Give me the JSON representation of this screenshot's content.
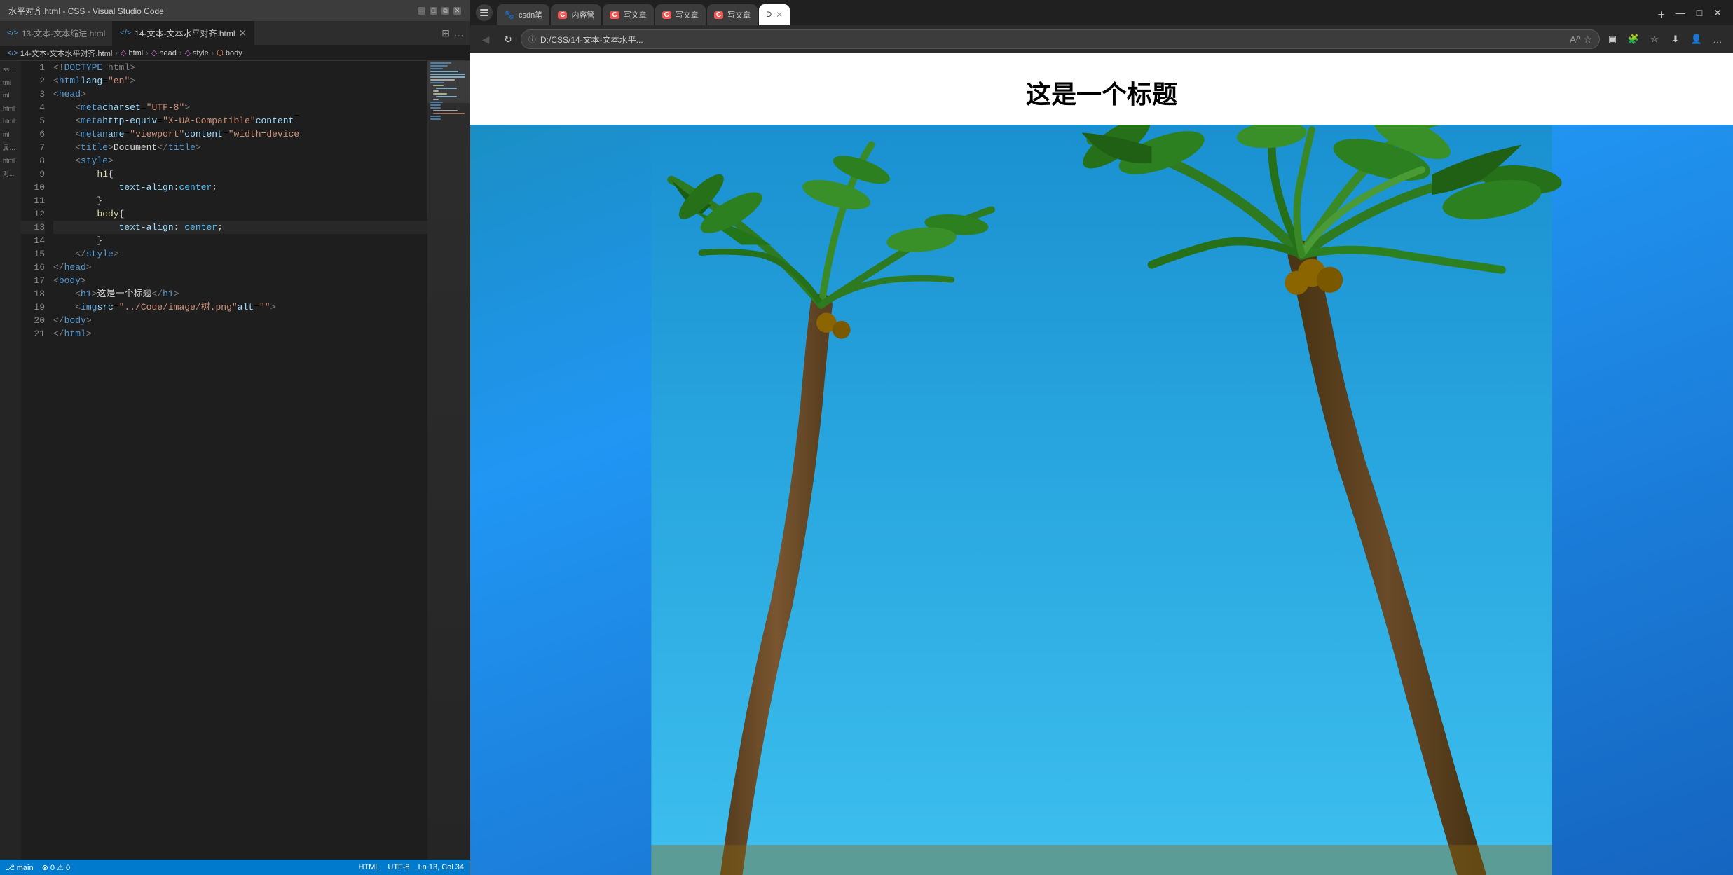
{
  "vscode": {
    "titlebar": {
      "title": "水平对齐.html - CSS - Visual Studio Code",
      "controls": [
        "minimize",
        "maximize",
        "restore",
        "close"
      ]
    },
    "tabs": [
      {
        "label": "13-文本-文本缩进.html",
        "icon": "</>",
        "active": false
      },
      {
        "label": "14-文本-文本水平对齐.html",
        "icon": "</>",
        "active": true
      }
    ],
    "breadcrumb": [
      "14-文本-文本水平对齐.html",
      "html",
      "head",
      "style",
      "body"
    ],
    "sidebar_items": [
      "css.h...",
      "html",
      "ml",
      "html",
      "html",
      "ml",
      "属性...",
      "html",
      "对..."
    ],
    "lines": [
      {
        "num": 1,
        "code": "<!DOCTYPE html>"
      },
      {
        "num": 2,
        "code": "<html lang=\"en\">"
      },
      {
        "num": 3,
        "code": "<head>"
      },
      {
        "num": 4,
        "code": "    <meta charset=\"UTF-8\">"
      },
      {
        "num": 5,
        "code": "    <meta http-equiv=\"X-UA-Compatible\" content="
      },
      {
        "num": 6,
        "code": "    <meta name=\"viewport\" content=\"width=device"
      },
      {
        "num": 7,
        "code": "    <title>Document</title>"
      },
      {
        "num": 8,
        "code": "    <style>"
      },
      {
        "num": 9,
        "code": "        h1 {"
      },
      {
        "num": 10,
        "code": "            text-align:center;"
      },
      {
        "num": 11,
        "code": "        }"
      },
      {
        "num": 12,
        "code": "        body {"
      },
      {
        "num": 13,
        "code": "            text-align: center;"
      },
      {
        "num": 14,
        "code": "        }"
      },
      {
        "num": 15,
        "code": "    </style>"
      },
      {
        "num": 16,
        "code": "</head>"
      },
      {
        "num": 17,
        "code": "<body>"
      },
      {
        "num": 18,
        "code": "    <h1>这是一个标题</h1>"
      },
      {
        "num": 19,
        "code": "    <img src=\"../Code/image/树.png\" alt=\"\">"
      },
      {
        "num": 20,
        "code": "</body>"
      },
      {
        "num": 21,
        "code": "</html>"
      }
    ]
  },
  "browser": {
    "tabs": [
      {
        "label": "csdn笔",
        "icon": "🐾",
        "active": false
      },
      {
        "label": "内容管",
        "icon": "C",
        "active": false,
        "color": "#e55"
      },
      {
        "label": "写文章",
        "icon": "C",
        "active": false,
        "color": "#e55"
      },
      {
        "label": "写文章",
        "icon": "C",
        "active": false,
        "color": "#e55"
      },
      {
        "label": "写文章",
        "icon": "C",
        "active": false,
        "color": "#e55"
      },
      {
        "label": "D",
        "icon": "D",
        "active": true
      }
    ],
    "address": "D:/CSS/14-文本-文本水平...",
    "page_title": "这是一个标题",
    "image_alt": "Palm trees photo"
  },
  "colors": {
    "vscode_bg": "#1e1e1e",
    "vscode_sidebar": "#252526",
    "vscode_tab_active": "#1e1e1e",
    "vscode_tab_inactive": "#2d2d2d",
    "browser_bg": "#ffffff",
    "accent": "#007acc",
    "sky_top": "#1a90d0",
    "sky_bottom": "#2196f3"
  }
}
